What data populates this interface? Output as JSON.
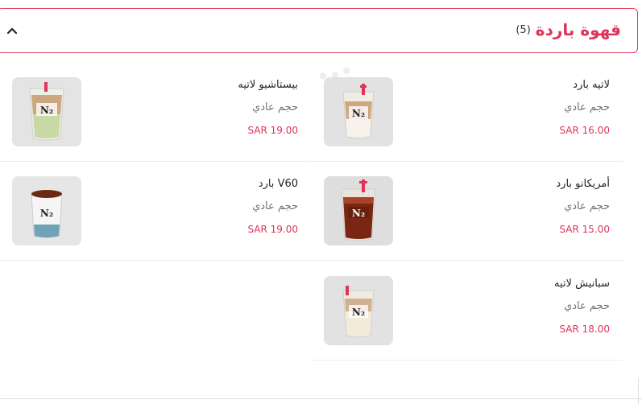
{
  "category": {
    "title": "قهوة باردة",
    "count": "(5)",
    "toggle_icon": "chevron-up-icon",
    "accent_color": "#e0335a"
  },
  "items": [
    {
      "name": "لاتيه بارد",
      "size": "حجم عادي",
      "price": "SAR 16.00",
      "image_icon": "iced-latte-cup-image"
    },
    {
      "name": "بيستاشيو لاتيه",
      "size": "حجم عادي",
      "price": "SAR 19.00",
      "image_icon": "pistachio-latte-cup-image"
    },
    {
      "name": "أمريكانو بارد",
      "size": "حجم عادي",
      "price": "SAR 15.00",
      "image_icon": "iced-americano-cup-image"
    },
    {
      "name": "V60 بارد",
      "size": "حجم عادي",
      "price": "SAR 19.00",
      "image_icon": "iced-v60-cup-image"
    },
    {
      "name": "سبانيش لاتيه",
      "size": "حجم عادي",
      "price": "SAR 18.00",
      "image_icon": "spanish-latte-cup-image"
    }
  ]
}
